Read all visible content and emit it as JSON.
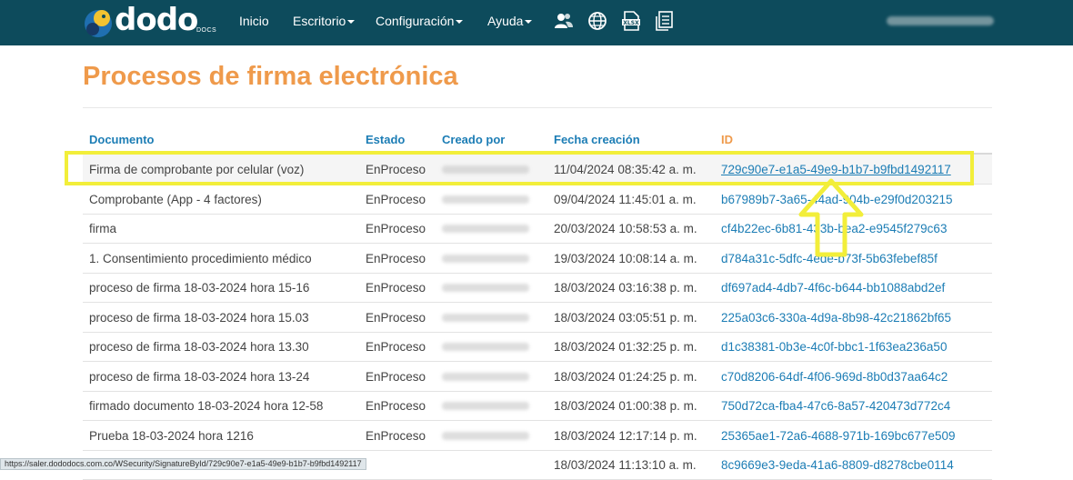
{
  "nav": {
    "logo_text": "dodo",
    "logo_sub": "DOCS",
    "items": [
      {
        "label": "Inicio"
      },
      {
        "label": "Escritorio"
      },
      {
        "label": "Configuración"
      },
      {
        "label": "Ayuda"
      }
    ],
    "icons": [
      "users-icon",
      "globe-icon",
      "xlsx-icon",
      "document-list-icon"
    ]
  },
  "page": {
    "title": "Procesos de firma electrónica"
  },
  "table": {
    "headers": {
      "documento": "Documento",
      "estado": "Estado",
      "creado_por": "Creado por",
      "fecha": "Fecha creación",
      "id": "ID"
    },
    "rows": [
      {
        "doc": "Firma de comprobante por celular (voz)",
        "estado": "EnProceso",
        "fecha": "11/04/2024 08:35:42 a. m.",
        "id": "729c90e7-e1a5-49e9-b1b7-b9fbd1492117"
      },
      {
        "doc": "Comprobante (App - 4 factores)",
        "estado": "EnProceso",
        "fecha": "09/04/2024 11:45:01 a. m.",
        "id": "b67989b7-3a65-44ad-904b-e29f0d203215"
      },
      {
        "doc": "firma",
        "estado": "EnProceso",
        "fecha": "20/03/2024 10:58:53 a. m.",
        "id": "cf4b22ec-6b81-433b-bea2-e9545f279c63"
      },
      {
        "doc": "1. Consentimiento procedimiento médico",
        "estado": "EnProceso",
        "fecha": "19/03/2024 10:08:14 a. m.",
        "id": "d784a31c-5dfc-4ede-b73f-5b63febef85f"
      },
      {
        "doc": "proceso de firma 18-03-2024 hora 15-16",
        "estado": "EnProceso",
        "fecha": "18/03/2024 03:16:38 p. m.",
        "id": "df697ad4-4db7-4f6c-b644-bb1088abd2ef"
      },
      {
        "doc": "proceso de firma 18-03-2024 hora 15.03",
        "estado": "EnProceso",
        "fecha": "18/03/2024 03:05:51 p. m.",
        "id": "225a03c6-330a-4d9a-8b98-42c21862bf65"
      },
      {
        "doc": "proceso de firma 18-03-2024 hora 13.30",
        "estado": "EnProceso",
        "fecha": "18/03/2024 01:32:25 p. m.",
        "id": "d1c38381-0b3e-4c0f-bbc1-1f63ea236a50"
      },
      {
        "doc": "proceso de firma 18-03-2024 hora 13-24",
        "estado": "EnProceso",
        "fecha": "18/03/2024 01:24:25 p. m.",
        "id": "c70d8206-64df-4f06-969d-8b0d37aa64c2"
      },
      {
        "doc": "firmado documento 18-03-2024 hora 12-58",
        "estado": "EnProceso",
        "fecha": "18/03/2024 01:00:38 p. m.",
        "id": "750d72ca-fba4-47c6-8a57-420473d772c4"
      },
      {
        "doc": "Prueba 18-03-2024 hora 1216",
        "estado": "EnProceso",
        "fecha": "18/03/2024 12:17:14 p. m.",
        "id": "25365ae1-72a6-4688-971b-169bc677e509"
      },
      {
        "doc": "",
        "estado": "",
        "fecha": "18/03/2024 11:13:10 a. m.",
        "id": "8c9669e3-9eda-41a6-8809-d8278cbe0114"
      }
    ]
  },
  "status_bar": {
    "url": "https://saler.dododocs.com.co/WSecurity/SignatureById/729c90e7-e1a5-49e9-b1b7-b9fbd1492117"
  },
  "colors": {
    "navbar": "#0d4b5c",
    "title": "#ef9a4b",
    "link": "#1c7db5",
    "highlight": "#f2ee3a"
  }
}
